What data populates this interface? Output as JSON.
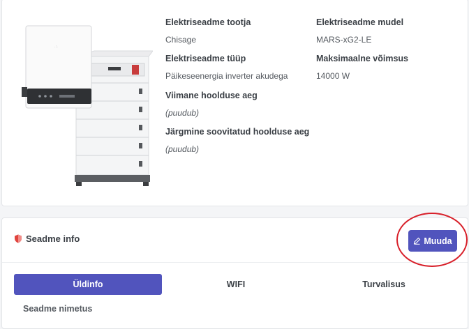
{
  "device": {
    "manufacturer": {
      "label": "Elektriseadme tootja",
      "value": "Chisage"
    },
    "model": {
      "label": "Elektriseadme mudel",
      "value": "MARS-xG2-LE"
    },
    "type": {
      "label": "Elektriseadme tüüp",
      "value": "Päikeseenergia inverter akudega"
    },
    "max_power": {
      "label": "Maksimaalne võimsus",
      "value": "14000 W"
    },
    "last_service": {
      "label": "Viimane hoolduse aeg",
      "value": "(puudub)"
    },
    "next_service": {
      "label": "Järgmine soovitatud hoolduse aeg",
      "value": "(puudub)"
    }
  },
  "info_card": {
    "title": "Seadme info",
    "title_icon": "shield-icon",
    "edit_button": {
      "label": "Muuda",
      "icon": "pencil-icon"
    },
    "tabs": [
      {
        "label": "Üldinfo",
        "active": true
      },
      {
        "label": "WIFI",
        "active": false
      },
      {
        "label": "Turvalisus",
        "active": false
      }
    ],
    "first_field_label": "Seadme nimetus"
  },
  "colors": {
    "accent": "#5154bd",
    "highlight": "#d8202a",
    "shield": "#e0443e"
  }
}
